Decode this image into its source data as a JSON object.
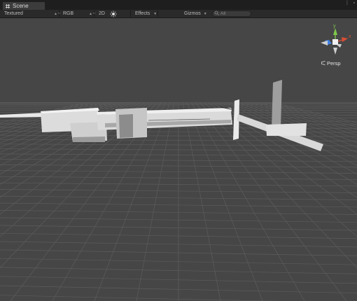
{
  "tab": {
    "title": "Scene",
    "icon": "scene-grid-icon"
  },
  "window_controls": {
    "menu_icon": "kebab-menu-icon",
    "maximize_icon": "maximize-icon"
  },
  "toolbar": {
    "draw_mode": "Textured",
    "render_mode": "RGB",
    "mode_2d": "2D",
    "lighting_icon": "sun-icon",
    "effects": "Effects",
    "gizmos": "Gizmos",
    "search_placeholder": "All",
    "search_icon": "search-icon"
  },
  "scene_gizmo": {
    "up_axis_label": "y",
    "side_axis_label": "x",
    "projection": "Persp",
    "projection_icon": "perspective-icon"
  },
  "colors": {
    "viewport_bg": "#464646",
    "grid_line": "#5e5e5e",
    "tab_bar": "#1e1e1e",
    "toolbar": "#2a2a2a",
    "model_fill": "#e3e3e3",
    "axis_x": "#d84e36",
    "axis_y": "#7ec84b",
    "axis_z": "#3e7fe0"
  }
}
